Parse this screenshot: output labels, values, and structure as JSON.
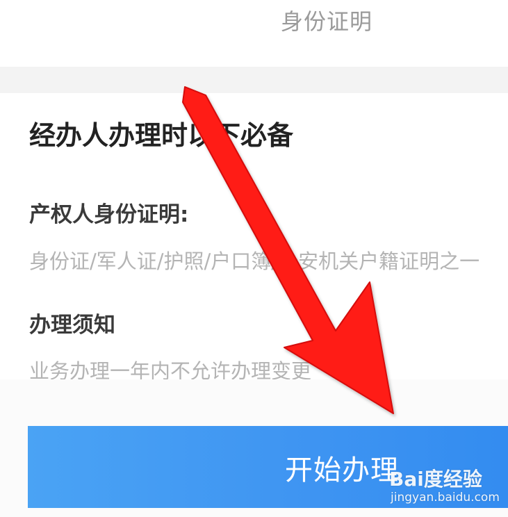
{
  "header": {
    "tab_label": "身份证明"
  },
  "card": {
    "heading": "经办人办理时以下必备",
    "documents": {
      "title": "产权人身份证明:",
      "description": "身份证/军人证/护照/户口簿/公安机关户籍证明之一"
    },
    "notice": {
      "title": "办理须知",
      "description": "业务办理一年内不允许办理变更"
    }
  },
  "actions": {
    "start_label": "开始办理"
  },
  "watermark": {
    "brand": "Bai度经验",
    "url": "jingyan.baidu.com"
  },
  "colors": {
    "button": "#3f95f2",
    "arrow": "#ff1a14",
    "heading": "#222222",
    "muted": "#b4b4b4"
  }
}
